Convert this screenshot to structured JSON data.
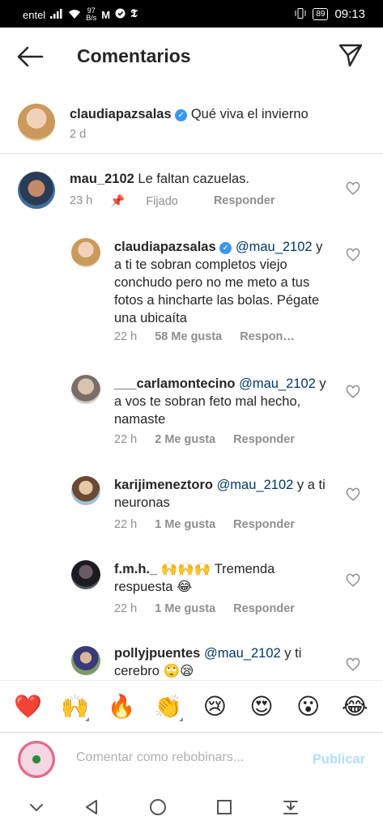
{
  "status_bar": {
    "carrier": "entel",
    "net_speed_value": "97",
    "net_speed_unit": "B/s",
    "battery": "89",
    "time": "09:13"
  },
  "header": {
    "title": "Comentarios"
  },
  "caption": {
    "username": "claudiapazsalas",
    "text": "Qué viva el invierno",
    "time": "2 d"
  },
  "comments": [
    {
      "username": "mau_2102",
      "text": "Le faltan cazuelas.",
      "time": "23 h",
      "pinned": "Fijado",
      "reply": "Responder"
    },
    {
      "username": "claudiapazsalas",
      "mention": "@mau_2102",
      "text": "y a ti te sobran completos viejo conchudo pero no me meto a tus fotos a hincharte las bolas. Pégate una ubicaíta",
      "time": "22 h",
      "likes": "58 Me gusta",
      "reply": "Respon…"
    },
    {
      "username": "___carlamontecino",
      "mention": "@mau_2102",
      "text": "y a vos te sobran feto mal hecho, namaste",
      "time": "22 h",
      "likes": "2 Me gusta",
      "reply": "Responder"
    },
    {
      "username": "karijimeneztoro",
      "mention": "@mau_2102",
      "text": "y a ti neuronas",
      "time": "22 h",
      "likes": "1 Me gusta",
      "reply": "Responder"
    },
    {
      "username": "f.m.h._ 🙌🙌🙌",
      "text": "Tremenda respuesta 😂",
      "time": "22 h",
      "likes": "1 Me gusta",
      "reply": "Responder"
    },
    {
      "username": "pollyjpuentes",
      "mention": "@mau_2102",
      "text": "y ti cerebro 🙄😪"
    }
  ],
  "emojis": [
    "❤️",
    "🙌",
    "🔥",
    "👏",
    "😢",
    "😍",
    "😮",
    "😂"
  ],
  "composer": {
    "placeholder": "Comentar como rebobinars...",
    "publish_label": "Publicar"
  },
  "colors": {
    "link_blue": "#00376b",
    "verified_blue": "#3897f0",
    "publish_disabled": "#b2dffc",
    "meta_gray": "#8e8e8e"
  }
}
